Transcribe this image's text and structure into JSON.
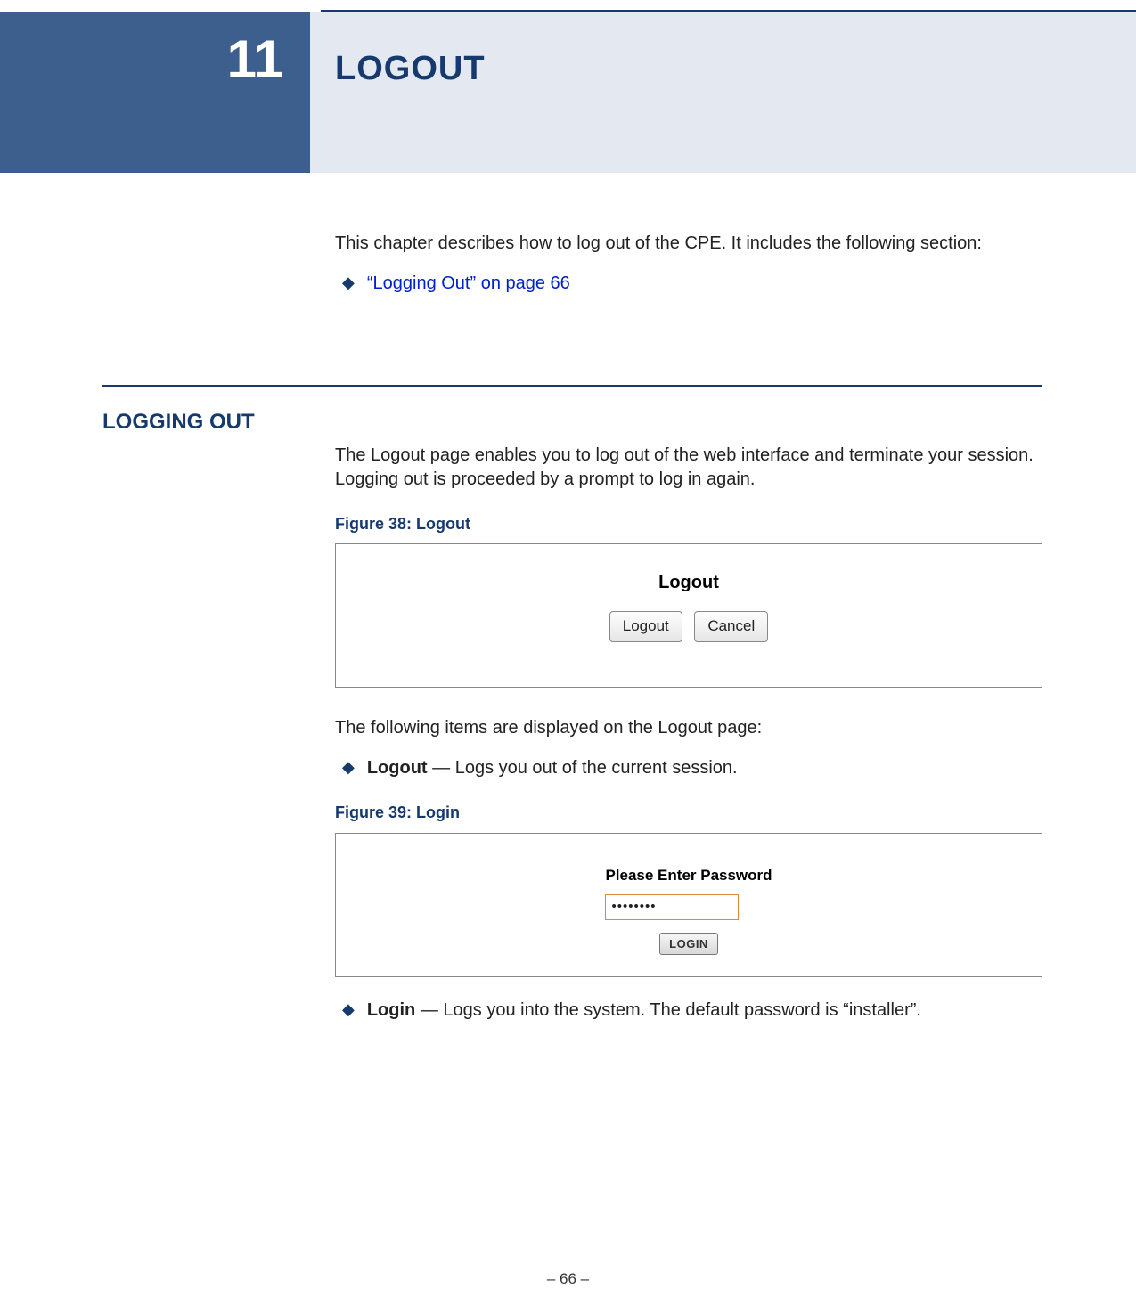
{
  "chapter_number": "11",
  "chapter_title": "LOGOUT",
  "intro_text": "This chapter describes how to log out of the CPE. It includes the following section:",
  "toc_link": "“Logging Out” on page 66",
  "section_heading": "LOGGING OUT",
  "section_intro": "The Logout page enables you to log out of the web interface and terminate your session. Logging out is proceeded by a prompt to log in again.",
  "figure38_caption": "Figure 38:  Logout",
  "figure38": {
    "title": "Logout",
    "logout_btn": "Logout",
    "cancel_btn": "Cancel"
  },
  "items_intro": "The following items are displayed on the Logout page:",
  "logout_item_bold": "Logout",
  "logout_item_rest": " — Logs you out of the current session.",
  "figure39_caption": "Figure 39:  Login",
  "figure39": {
    "prompt": "Please Enter Password",
    "password_masked": "••••••••",
    "login_btn": "LOGIN"
  },
  "login_item_bold": "Login",
  "login_item_rest": " — Logs you into the system. The default password is “installer”.",
  "page_footer": "–  66  –"
}
